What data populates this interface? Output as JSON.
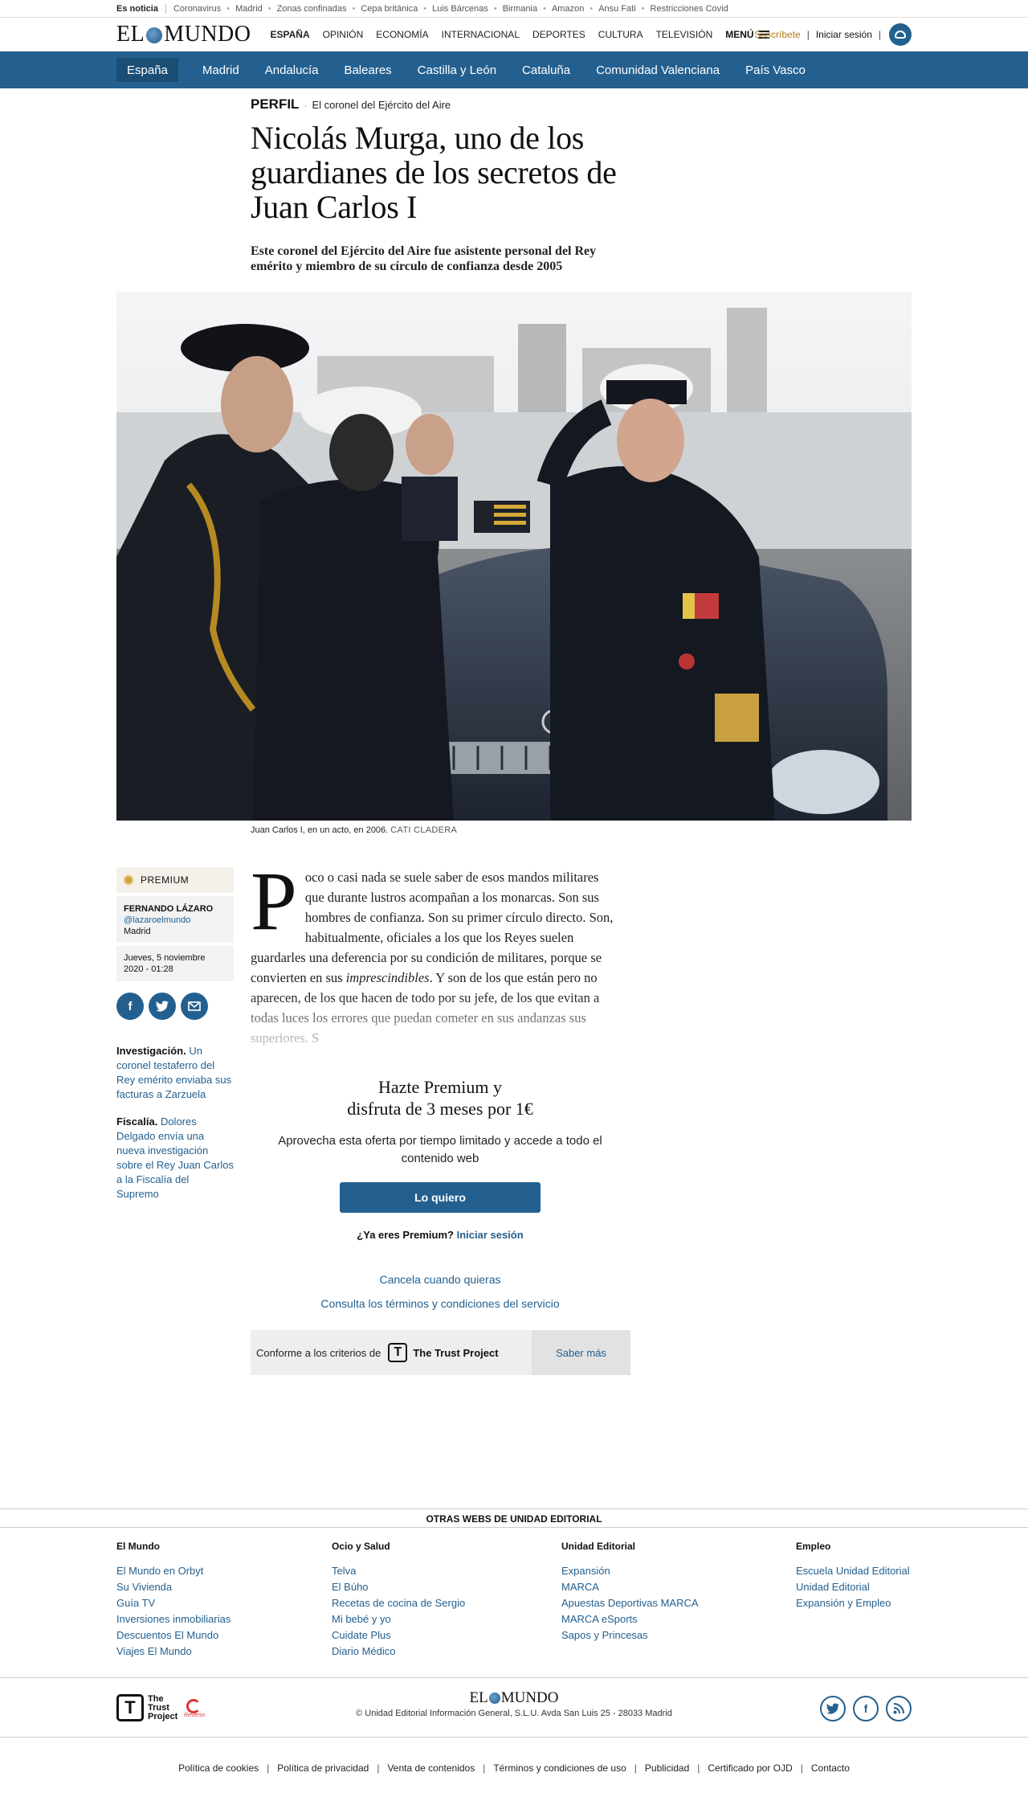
{
  "trending": {
    "lead": "Es noticia",
    "items": [
      "Coronavirus",
      "Madrid",
      "Zonas confinadas",
      "Cepa británica",
      "Luis Bárcenas",
      "Birmania",
      "Amazon",
      "Ansu Fati",
      "Restricciones Covid"
    ]
  },
  "header": {
    "logo_left": "EL",
    "logo_right": "MUNDO",
    "nav": [
      "ESPAÑA",
      "OPINIÓN",
      "ECONOMÍA",
      "INTERNACIONAL",
      "DEPORTES",
      "CULTURA",
      "TELEVISIÓN"
    ],
    "menu_label": "MENÚ",
    "subscribe": "Suscríbete",
    "login": "Iniciar sesión",
    "divider": "|"
  },
  "section_nav": [
    "España",
    "Madrid",
    "Andalucía",
    "Baleares",
    "Castilla y León",
    "Cataluña",
    "Comunidad Valenciana",
    "País Vasco"
  ],
  "article": {
    "kicker": "PERFIL",
    "kicker_dot": "·",
    "kicker_sub": "El coronel del Ejército del Aire",
    "headline": "Nicolás Murga, uno de los guardianes de los secretos de Juan Carlos I",
    "standfirst": "Este coronel del Ejército del Aire fue asistente personal del Rey emérito y miembro de su círculo de confianza desde 2005",
    "caption": "Juan Carlos I, en un acto, en 2006.",
    "credit": "CATI CLADERA",
    "dropcap": "P",
    "body_text": "oco o casi nada se suele saber de esos mandos militares que durante lustros acompañan a los monarcas. Son sus hombres de confianza. Son su primer círculo directo. Son, habitualmente, oficiales a los que los Reyes suelen guardarles una deferencia por su condición de militares, porque se convierten en sus",
    "body_italic": "imprescindibles",
    "body_text2": ". Y son de los que están pero no aparecen, de los que hacen de todo por su jefe, de los que evitan a todas luces los errores que puedan cometer en sus andanzas sus superiores. S"
  },
  "sidebar": {
    "premium": "PREMIUM",
    "author": "FERNANDO LÁZARO",
    "handle": "@lazaroelmundo",
    "location": "Madrid",
    "date": "Jueves, 5 noviembre 2020 - 01:28",
    "share": [
      "facebook-icon",
      "twitter-icon",
      "mail-icon"
    ],
    "related": [
      {
        "label": "Investigación.",
        "text": "Un coronel testaferro del Rey emérito enviaba sus facturas a Zarzuela"
      },
      {
        "label": "Fiscalía.",
        "text": "Dolores Delgado envía una nueva investigación sobre el Rey Juan Carlos a la Fiscalía del Supremo"
      }
    ]
  },
  "paywall": {
    "title_line1": "Hazte Premium y",
    "title_line2": "disfruta de 3 meses por 1€",
    "text": "Aprovecha esta oferta por tiempo limitado y accede a todo el contenido web",
    "button": "Lo quiero",
    "already": "¿Ya eres Premium?",
    "login": "Iniciar sesión",
    "cancel": "Cancela cuando quieras",
    "terms": "Consulta los términos y condiciones del servicio"
  },
  "trust": {
    "text": "Conforme a los criterios de",
    "brand": "The Trust Project",
    "more": "Saber más"
  },
  "footer": {
    "otras": "OTRAS WEBS DE UNIDAD EDITORIAL",
    "columns": [
      {
        "title": "El Mundo",
        "links": [
          "El Mundo en Orbyt",
          "Su Vivienda",
          "Guía TV",
          "Inversiones inmobiliarias",
          "Descuentos El Mundo",
          "Viajes El Mundo"
        ]
      },
      {
        "title": "Ocio y Salud",
        "links": [
          "Telva",
          "El Búho",
          "Recetas de cocina de Sergio",
          "Mi bebé y yo",
          "Cuidate Plus",
          "Diario Médico"
        ]
      },
      {
        "title": "Unidad Editorial",
        "links": [
          "Expansión",
          "MARCA",
          "Apuestas Deportivas MARCA",
          "MARCA eSports",
          "Sapos y Princesas"
        ]
      },
      {
        "title": "Empleo",
        "links": [
          "Escuela Unidad Editorial",
          "Unidad Editorial",
          "Expansión y Empleo"
        ]
      }
    ],
    "trust_text": "The Trust Project",
    "reverso": "Reverso",
    "copyright": "© Unidad Editorial Información General, S.L.U. Avda San Luis 25 - 28033 Madrid",
    "social": [
      "twitter-icon",
      "facebook-icon",
      "rss-icon"
    ],
    "legal": [
      "Política de cookies",
      "Política de privacidad",
      "Venta de contenidos",
      "Términos y condiciones de uso",
      "Publicidad",
      "Certificado por OJD",
      "Contacto"
    ]
  }
}
